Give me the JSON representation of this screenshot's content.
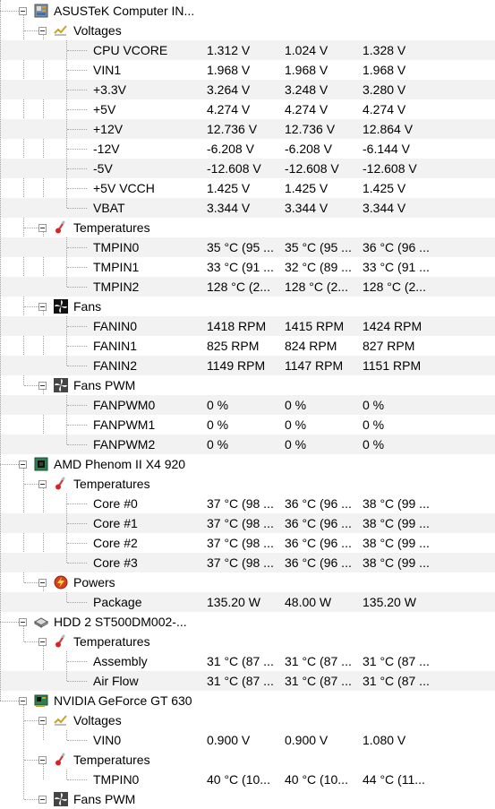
{
  "tree": [
    {
      "level": 0,
      "label": "ASUSTeK Computer IN...",
      "icon": "motherboard-icon",
      "expanded": true
    },
    {
      "level": 1,
      "label": "Voltages",
      "icon": "voltage-icon",
      "expanded": true
    },
    {
      "level": 2,
      "label": "CPU VCORE",
      "values": [
        "1.312 V",
        "1.024 V",
        "1.328 V"
      ]
    },
    {
      "level": 2,
      "label": "VIN1",
      "values": [
        "1.968 V",
        "1.968 V",
        "1.968 V"
      ]
    },
    {
      "level": 2,
      "label": "+3.3V",
      "values": [
        "3.264 V",
        "3.248 V",
        "3.280 V"
      ]
    },
    {
      "level": 2,
      "label": "+5V",
      "values": [
        "4.274 V",
        "4.274 V",
        "4.274 V"
      ]
    },
    {
      "level": 2,
      "label": "+12V",
      "values": [
        "12.736 V",
        "12.736 V",
        "12.864 V"
      ]
    },
    {
      "level": 2,
      "label": "-12V",
      "values": [
        "-6.208 V",
        "-6.208 V",
        "-6.144 V"
      ]
    },
    {
      "level": 2,
      "label": "-5V",
      "values": [
        "-12.608 V",
        "-12.608 V",
        "-12.608 V"
      ]
    },
    {
      "level": 2,
      "label": "+5V VCCH",
      "values": [
        "1.425 V",
        "1.425 V",
        "1.425 V"
      ]
    },
    {
      "level": 2,
      "label": "VBAT",
      "values": [
        "3.344 V",
        "3.344 V",
        "3.344 V"
      ]
    },
    {
      "level": 1,
      "label": "Temperatures",
      "icon": "thermometer-icon",
      "expanded": true
    },
    {
      "level": 2,
      "label": "TMPIN0",
      "values": [
        "35 °C  (95 ...",
        "35 °C  (95 ...",
        "36 °C  (96 ..."
      ]
    },
    {
      "level": 2,
      "label": "TMPIN1",
      "values": [
        "33 °C  (91 ...",
        "32 °C  (89 ...",
        "33 °C  (91 ..."
      ]
    },
    {
      "level": 2,
      "label": "TMPIN2",
      "values": [
        "128 °C  (2...",
        "128 °C  (2...",
        "128 °C  (2..."
      ]
    },
    {
      "level": 1,
      "label": "Fans",
      "icon": "fan-icon",
      "expanded": true
    },
    {
      "level": 2,
      "label": "FANIN0",
      "values": [
        "1418 RPM",
        "1415 RPM",
        "1424 RPM"
      ]
    },
    {
      "level": 2,
      "label": "FANIN1",
      "values": [
        "825 RPM",
        "824 RPM",
        "827 RPM"
      ]
    },
    {
      "level": 2,
      "label": "FANIN2",
      "values": [
        "1149 RPM",
        "1147 RPM",
        "1151 RPM"
      ]
    },
    {
      "level": 1,
      "label": "Fans PWM",
      "icon": "fan-pwm-icon",
      "expanded": true
    },
    {
      "level": 2,
      "label": "FANPWM0",
      "values": [
        "0 %",
        "0 %",
        "0 %"
      ]
    },
    {
      "level": 2,
      "label": "FANPWM1",
      "values": [
        "0 %",
        "0 %",
        "0 %"
      ]
    },
    {
      "level": 2,
      "label": "FANPWM2",
      "values": [
        "0 %",
        "0 %",
        "0 %"
      ]
    },
    {
      "level": 0,
      "label": "AMD Phenom II X4 920",
      "icon": "cpu-icon",
      "expanded": true
    },
    {
      "level": 1,
      "label": "Temperatures",
      "icon": "thermometer-icon",
      "expanded": true
    },
    {
      "level": 2,
      "label": "Core #0",
      "values": [
        "37 °C  (98 ...",
        "36 °C  (96 ...",
        "38 °C  (99 ..."
      ]
    },
    {
      "level": 2,
      "label": "Core #1",
      "values": [
        "37 °C  (98 ...",
        "36 °C  (96 ...",
        "38 °C  (99 ..."
      ]
    },
    {
      "level": 2,
      "label": "Core #2",
      "values": [
        "37 °C  (98 ...",
        "36 °C  (96 ...",
        "38 °C  (99 ..."
      ]
    },
    {
      "level": 2,
      "label": "Core #3",
      "values": [
        "37 °C  (98 ...",
        "36 °C  (96 ...",
        "38 °C  (99 ..."
      ]
    },
    {
      "level": 1,
      "label": "Powers",
      "icon": "power-icon",
      "expanded": true
    },
    {
      "level": 2,
      "label": "Package",
      "values": [
        "135.20 W",
        "48.00 W",
        "135.20 W"
      ]
    },
    {
      "level": 0,
      "label": "HDD 2 ST500DM002-...",
      "icon": "hdd-icon",
      "expanded": true
    },
    {
      "level": 1,
      "label": "Temperatures",
      "icon": "thermometer-icon",
      "expanded": true
    },
    {
      "level": 2,
      "label": "Assembly",
      "values": [
        "31 °C  (87 ...",
        "31 °C  (87 ...",
        "31 °C  (87 ..."
      ]
    },
    {
      "level": 2,
      "label": "Air Flow",
      "values": [
        "31 °C  (87 ...",
        "31 °C  (87 ...",
        "31 °C  (87 ..."
      ]
    },
    {
      "level": 0,
      "label": "NVIDIA GeForce GT 630",
      "icon": "gpu-icon",
      "expanded": true
    },
    {
      "level": 1,
      "label": "Voltages",
      "icon": "voltage-icon",
      "expanded": true
    },
    {
      "level": 2,
      "label": "VIN0",
      "values": [
        "0.900 V",
        "0.900 V",
        "1.080 V"
      ]
    },
    {
      "level": 1,
      "label": "Temperatures",
      "icon": "thermometer-icon",
      "expanded": true
    },
    {
      "level": 2,
      "label": "TMPIN0",
      "values": [
        "40 °C  (10...",
        "40 °C  (10...",
        "44 °C  (11..."
      ]
    },
    {
      "level": 1,
      "label": "Fans PWM",
      "icon": "fan-pwm-icon",
      "expanded": true
    }
  ]
}
